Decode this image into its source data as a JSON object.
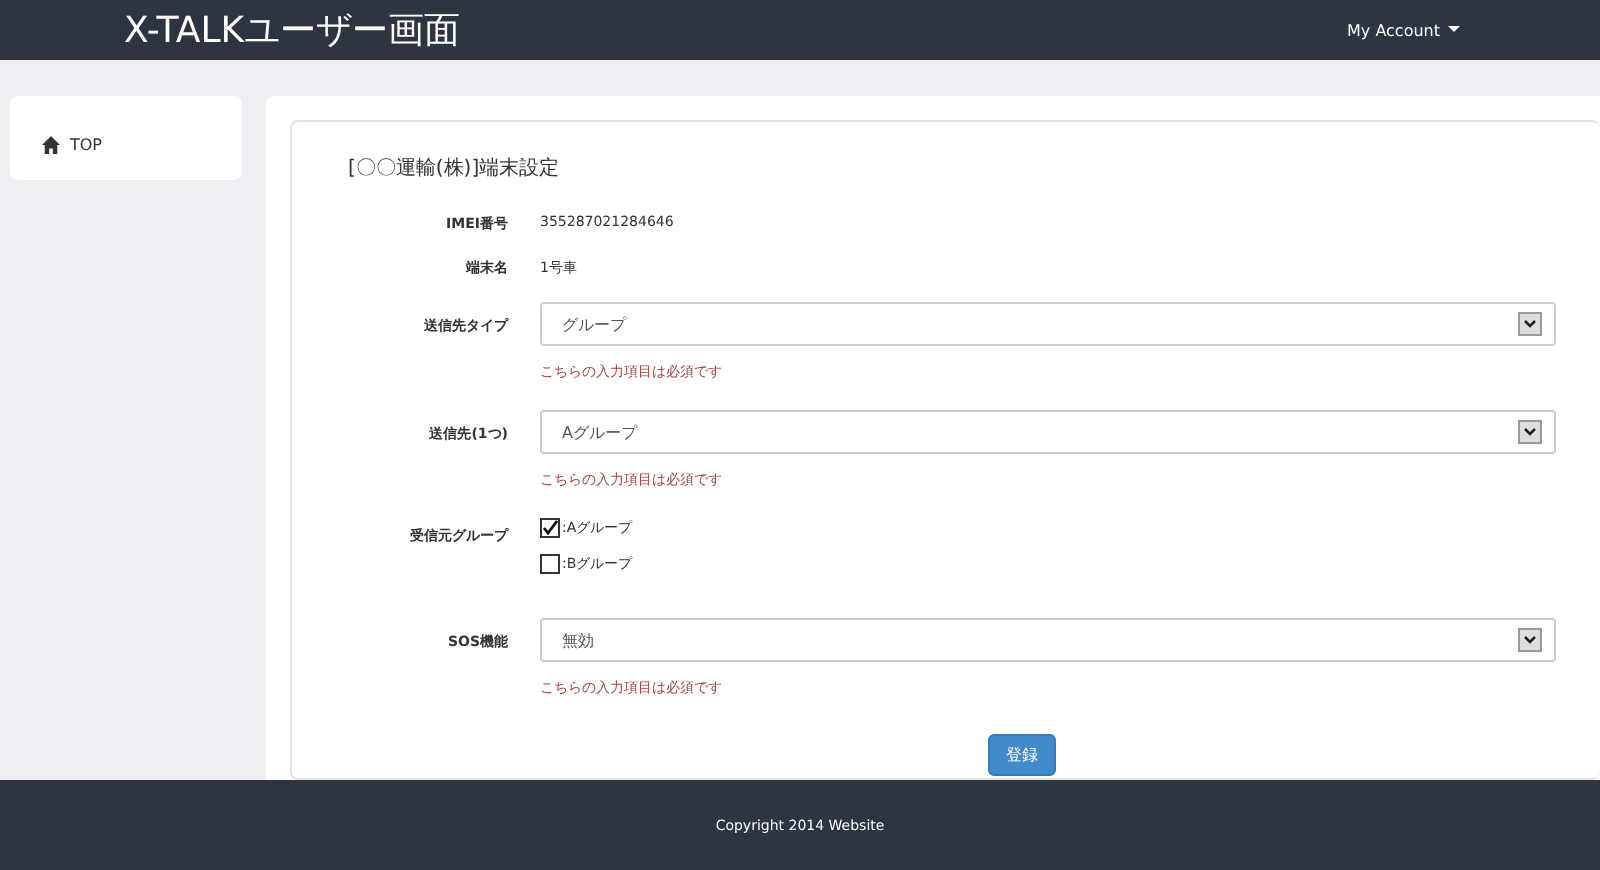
{
  "header": {
    "title": "X-TALKユーザー画面",
    "account_menu": "My Account"
  },
  "sidebar": {
    "items": [
      {
        "label": "TOP",
        "selected": false
      }
    ]
  },
  "form": {
    "title": "[〇〇運輸(株)]端末設定",
    "fields": [
      {
        "kind": "text",
        "label": "IMEI番号",
        "value": "355287021284646"
      },
      {
        "kind": "text",
        "label": "端末名",
        "value": "1号車"
      },
      {
        "kind": "select",
        "label": "送信先タイプ",
        "value": "グループ",
        "error": "こちらの入力項目は必須です"
      },
      {
        "kind": "select",
        "label": "送信先(1つ)",
        "value": "Aグループ",
        "error": "こちらの入力項目は必須です"
      },
      {
        "kind": "checkboxes",
        "label": "受信元グループ",
        "options": [
          {
            "label": ":Aグループ",
            "checked": true
          },
          {
            "label": ":Bグループ",
            "checked": false
          }
        ]
      },
      {
        "kind": "select",
        "label": "SOS機能",
        "value": "無効",
        "error": "こちらの入力項目は必須です"
      }
    ],
    "submit": "登録"
  },
  "footer": {
    "text": "Copyright 2014 Website"
  }
}
